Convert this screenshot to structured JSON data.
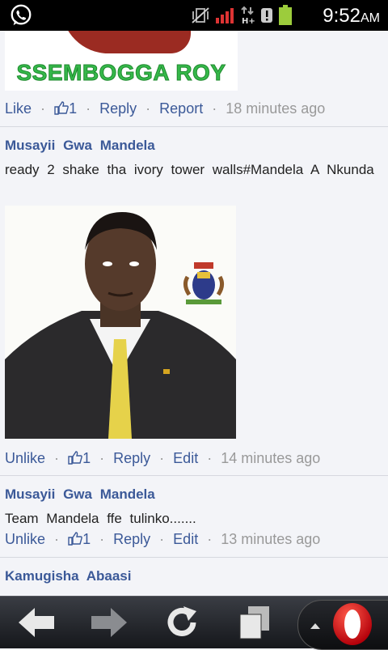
{
  "status_bar": {
    "time": "9:52",
    "ampm": "AM",
    "icons": [
      "whatsapp-icon",
      "vibrate-icon",
      "signal-icon",
      "hplus-data-icon",
      "alert-icon",
      "battery-icon"
    ]
  },
  "top_image": {
    "caption": "SSEMBOGGA ROY"
  },
  "posts": [
    {
      "actions": {
        "like": "Like",
        "count": "1",
        "reply": "Reply",
        "extra": "Report",
        "time": "18 minutes ago"
      }
    },
    {
      "author": "Musayii Gwa Mandela",
      "text": "ready 2 shake tha ivory tower walls#Mandela A Nkunda",
      "actions": {
        "like": "Unlike",
        "count": "1",
        "reply": "Reply",
        "extra": "Edit",
        "time": "14 minutes ago"
      }
    },
    {
      "author": "Musayii Gwa Mandela",
      "text": "Team Mandela ffe tulinko.......",
      "actions": {
        "like": "Unlike",
        "count": "1",
        "reply": "Reply",
        "extra": "Edit",
        "time": "13 minutes ago"
      }
    },
    {
      "author": "Kamugisha Abaasi"
    }
  ],
  "separator": "·",
  "nav": [
    "back-icon",
    "forward-icon",
    "reload-icon",
    "tabs-icon",
    "opera-menu-icon"
  ]
}
